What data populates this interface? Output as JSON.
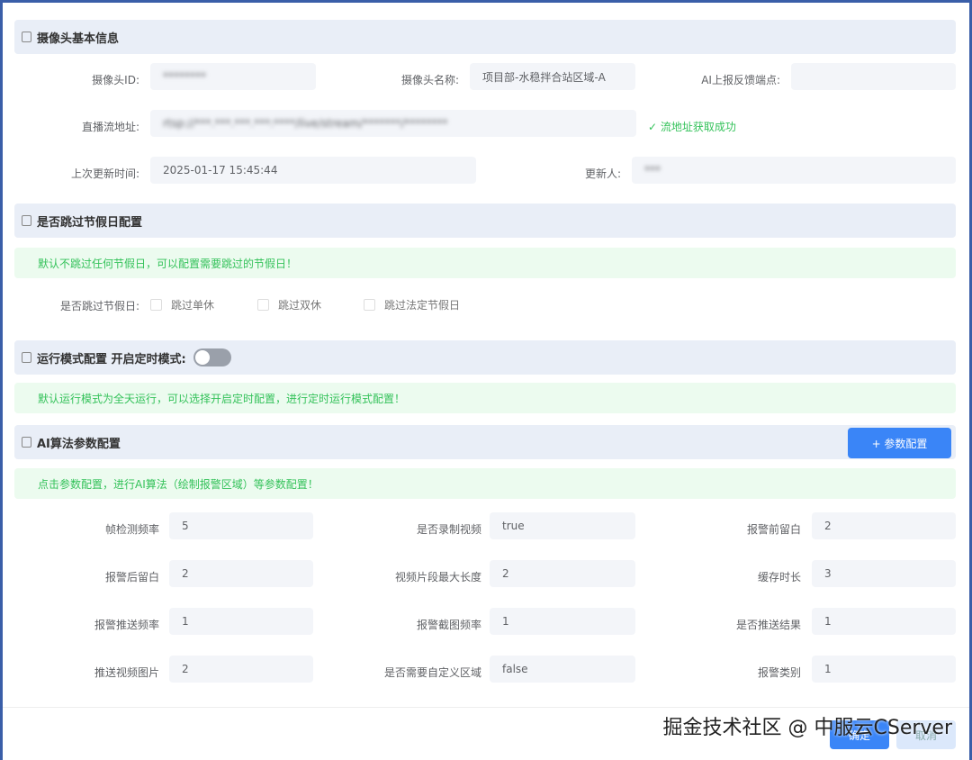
{
  "basic": {
    "title": "摄像头基本信息",
    "camera_id_label": "摄像头ID:",
    "camera_id": "********",
    "camera_name_label": "摄像头名称:",
    "camera_name": "项目部-水稳拌合站区域-A",
    "ai_endpoint_label": "AI上报反馈端点:",
    "ai_endpoint": "",
    "stream_label": "直播流地址:",
    "stream": "rtsp://***.***.***.***:****/live/stream/*******/********",
    "stream_status": "✓ 流地址获取成功",
    "updated_label": "上次更新时间:",
    "updated": "2025-01-17 15:45:44",
    "updater_label": "更新人:",
    "updater": "***"
  },
  "holiday": {
    "title": "是否跳过节假日配置",
    "tip": "默认不跳过任何节假日，可以配置需要跳过的节假日！",
    "label": "是否跳过节假日:",
    "options": [
      "跳过单休",
      "跳过双休",
      "跳过法定节假日"
    ]
  },
  "mode": {
    "title": "运行模式配置 开启定时模式:",
    "timed_enabled": false,
    "tip": "默认运行模式为全天运行，可以选择开启定时配置，进行定时运行模式配置！"
  },
  "ai": {
    "title": "AI算法参数配置",
    "config_button": "+ 参数配置",
    "tip": "点击参数配置，进行AI算法（绘制报警区域）等参数配置！",
    "params": [
      {
        "label": "帧检测频率",
        "value": "5"
      },
      {
        "label": "是否录制视频",
        "value": "true"
      },
      {
        "label": "报警前留白",
        "value": "2"
      },
      {
        "label": "报警后留白",
        "value": "2"
      },
      {
        "label": "视频片段最大长度",
        "value": "2"
      },
      {
        "label": "缓存时长",
        "value": "3"
      },
      {
        "label": "报警推送频率",
        "value": "1"
      },
      {
        "label": "报警截图频率",
        "value": "1"
      },
      {
        "label": "是否推送结果",
        "value": "1"
      },
      {
        "label": "推送视频图片",
        "value": "2"
      },
      {
        "label": "是否需要自定义区域",
        "value": "false"
      },
      {
        "label": "报警类别",
        "value": "1"
      }
    ]
  },
  "footer": {
    "confirm": "确定",
    "cancel": "取消"
  },
  "watermark": "掘金技术社区 @ 中服云CServer",
  "colors": {
    "primary": "#3a85f7",
    "success": "#34c25a",
    "section_bg": "#e9eef7"
  }
}
